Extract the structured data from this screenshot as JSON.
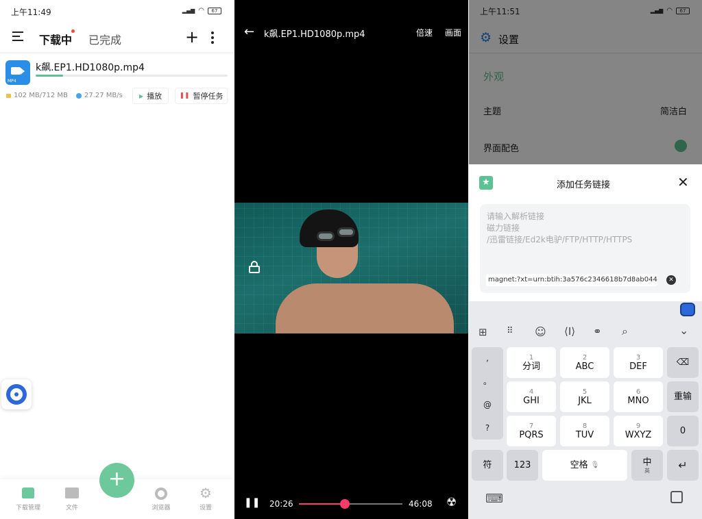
{
  "screen1": {
    "status": {
      "time": "上午11:49",
      "battery": "67"
    },
    "tabs": {
      "downloading": "下载中",
      "completed": "已完成"
    },
    "task": {
      "filename": "k飙.EP1.HD1080p.mp4",
      "file_badge": "MP4",
      "size": "102 MB/712 MB",
      "speed": "27.27 MB/s",
      "progress": 0.143,
      "play_label": "播放",
      "pause_label": "暂停任务"
    },
    "bottom_nav": [
      {
        "label": "下载管理",
        "icon": "home-icon"
      },
      {
        "label": "文件",
        "icon": "folder-icon"
      },
      {
        "label": "浏览器",
        "icon": "chrome-icon"
      },
      {
        "label": "设置",
        "icon": "gear-icon"
      }
    ],
    "colors": {
      "accent": "#5cc193",
      "fab": "#6dc99b"
    }
  },
  "screen2": {
    "title": "k飙.EP1.HD1080p.mp4",
    "speed_label": "倍速",
    "picture_label": "画面",
    "current_time": "20:26",
    "total_time": "46:08",
    "progress": 0.443,
    "colors": {
      "progress": "#ff3b6b"
    }
  },
  "screen3": {
    "status": {
      "time": "上午11:51",
      "battery": "67"
    },
    "header_title": "设置",
    "section_title": "外观",
    "theme": {
      "label": "主题",
      "value": "简洁白"
    },
    "color_scheme": {
      "label": "界面配色"
    },
    "dialog": {
      "title": "添加任务链接",
      "placeholder_lines": [
        "请输入解析链接",
        "磁力链接",
        "/迅雷链接/Ed2k电驴/FTP/HTTP/HTTPS"
      ],
      "link_value": "magnet:?xt=urn:btih:3a576c2346618b7d8ab044f…"
    },
    "keyboard": {
      "side_keys": [
        ",",
        "。",
        "@",
        "?"
      ],
      "keys": [
        {
          "num": "1",
          "main": "分词"
        },
        {
          "num": "2",
          "main": "ABC"
        },
        {
          "num": "3",
          "main": "DEF"
        },
        {
          "num": "4",
          "main": "GHI"
        },
        {
          "num": "5",
          "main": "JKL"
        },
        {
          "num": "6",
          "main": "MNO"
        },
        {
          "num": "7",
          "main": "PQRS"
        },
        {
          "num": "8",
          "main": "TUV"
        },
        {
          "num": "9",
          "main": "WXYZ"
        }
      ],
      "reenter": "重输",
      "zero": "0",
      "fu": "符",
      "num123": "123",
      "space": "空格",
      "zh": "中",
      "en": "英"
    }
  }
}
